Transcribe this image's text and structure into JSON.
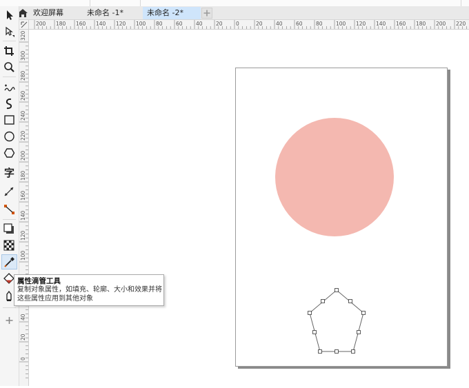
{
  "tabs": [
    {
      "label": "欢迎屏幕",
      "active": false
    },
    {
      "label": "未命名 -1*",
      "active": false
    },
    {
      "label": "未命名 -2*",
      "active": true
    }
  ],
  "tools": [
    {
      "icon": "pick-tool-icon"
    },
    {
      "icon": "shape-tool-icon"
    },
    {
      "icon": "crop-tool-icon"
    },
    {
      "icon": "zoom-tool-icon"
    },
    {
      "icon": "freehand-tool-icon"
    },
    {
      "icon": "artistic-media-tool-icon"
    },
    {
      "icon": "rectangle-tool-icon"
    },
    {
      "icon": "ellipse-tool-icon"
    },
    {
      "icon": "polygon-tool-icon"
    },
    {
      "icon": "text-tool-icon",
      "glyph": "字"
    },
    {
      "icon": "parallel-dimension-tool-icon"
    },
    {
      "icon": "connector-tool-icon"
    },
    {
      "icon": "drop-shadow-tool-icon"
    },
    {
      "icon": "transparency-tool-icon"
    },
    {
      "icon": "eyedropper-tool-icon",
      "active": true
    },
    {
      "icon": "interactive-fill-tool-icon"
    },
    {
      "icon": "smart-fill-tool-icon"
    },
    {
      "icon": "add-tool-icon"
    }
  ],
  "ruler": {
    "horizontal_labels": [
      "200",
      "180",
      "160",
      "140",
      "120",
      "100",
      "80",
      "60",
      "40",
      "20",
      "0",
      "20",
      "40",
      "60",
      "80",
      "100",
      "120",
      "140",
      "160",
      "180",
      "200",
      "220"
    ],
    "vertical_labels": [
      "320",
      "300",
      "280",
      "260",
      "240",
      "220",
      "200",
      "180",
      "160",
      "140",
      "120",
      "100",
      "80",
      "60",
      "40",
      "20",
      "0"
    ]
  },
  "tooltip": {
    "title": "属性滴管工具",
    "line1": "复制对象属性，如填充、轮廓、大小和效果并将",
    "line2": "这些属性应用到其他对象"
  },
  "colors": {
    "circle_fill": "#f4b8b0",
    "active_tab": "#cfe5fb",
    "outline": "#666666"
  }
}
